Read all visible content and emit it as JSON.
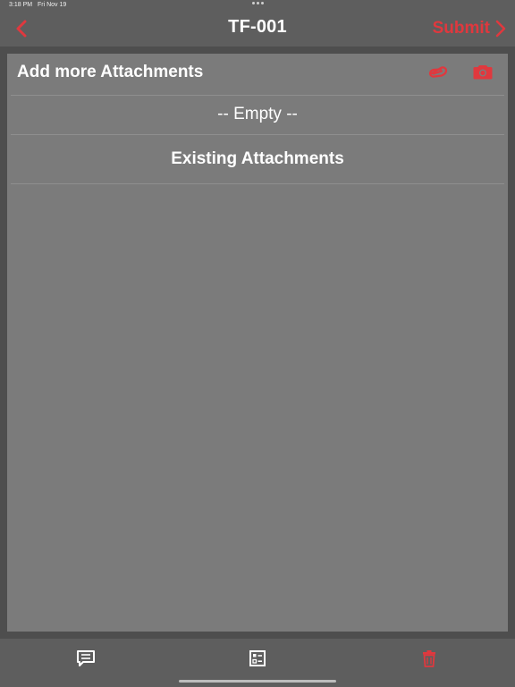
{
  "status_bar": {
    "time": "3:18 PM",
    "date": "Fri Nov 19"
  },
  "nav": {
    "title": "TF-001",
    "submit_label": "Submit",
    "back_icon": "chevron-left-icon",
    "submit_icon": "chevron-right-icon"
  },
  "attachments": {
    "add_label": "Add more Attachments",
    "add_icons": [
      "paperclip-icon",
      "camera-icon"
    ],
    "empty_label": "-- Empty --",
    "existing_label": "Existing Attachments"
  },
  "tab_bar": {
    "items": [
      "comment-icon",
      "checklist-icon",
      "trash-icon"
    ]
  },
  "colors": {
    "accent": "#e0383e",
    "panel": "#7b7b7b",
    "background": "#5e5e5e"
  }
}
